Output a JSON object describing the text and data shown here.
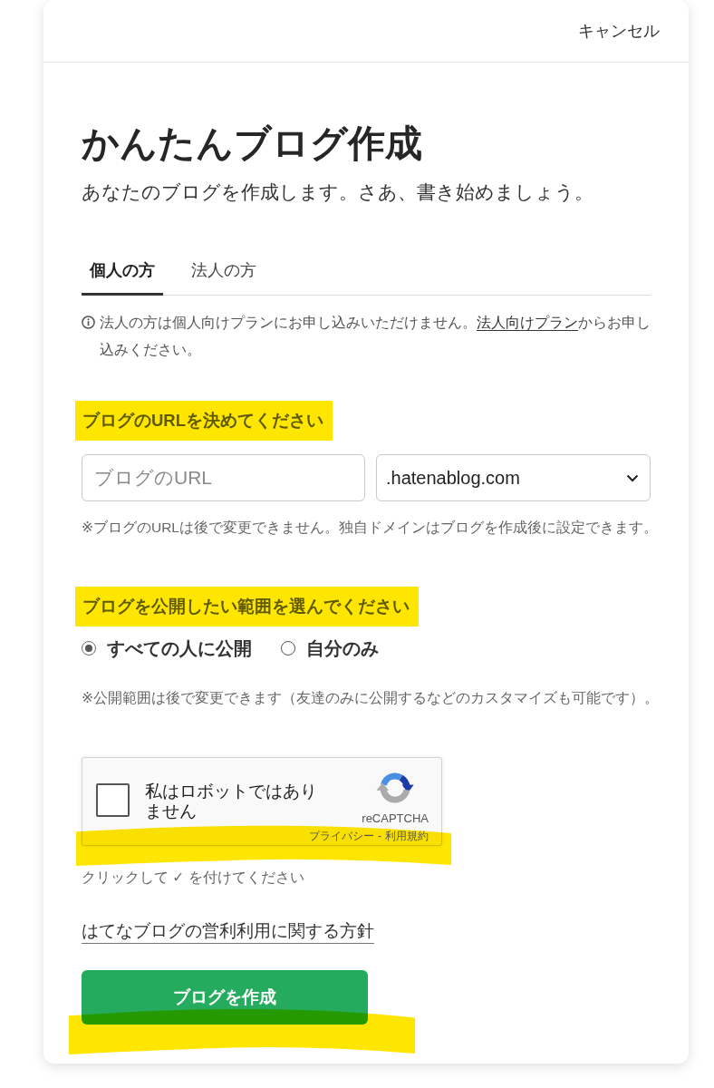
{
  "header": {
    "cancel": "キャンセル"
  },
  "title": "かんたんブログ作成",
  "subtitle": "あなたのブログを作成します。さあ、書き始めましょう。",
  "tabs": [
    {
      "label": "個人の方",
      "selected": true
    },
    {
      "label": "法人の方",
      "selected": false
    }
  ],
  "notice": {
    "text_before": "法人の方は個人向けプランにお申し込みいただけません。",
    "link": "法人向けプラン",
    "text_after": "からお申し込みください。"
  },
  "url_section": {
    "heading": "ブログのURLを決めてください",
    "highlighted": true,
    "url_field": {
      "placeholder": "ブログのURL"
    },
    "domain_select": {
      "value": ".hatenablog.com"
    },
    "note": "※ブログのURLは後で変更できません。独自ドメインはブログを作成後に設定できます。"
  },
  "visibility_section": {
    "heading": "ブログを公開したい範囲を選んでください",
    "highlighted": true,
    "options": [
      {
        "label": "すべての人に公開",
        "selected": true
      },
      {
        "label": "自分のみ",
        "selected": false
      }
    ],
    "note": "※公開範囲は後で変更できます（友達のみに公開するなどのカスタマイズも可能です）。"
  },
  "recaptcha": {
    "label": "私はロボットではありません",
    "checked": false,
    "brand": "reCAPTCHA",
    "privacy_link": "プライバシー",
    "separator": "-",
    "terms_link": "利用規約",
    "highlighted": true
  },
  "recaptcha_hint": "クリックして ✓ を付けてください",
  "policy_link": "はてなブログの営利利用に関する方針",
  "submit": {
    "label": "ブログを作成",
    "highlighted": true
  }
}
